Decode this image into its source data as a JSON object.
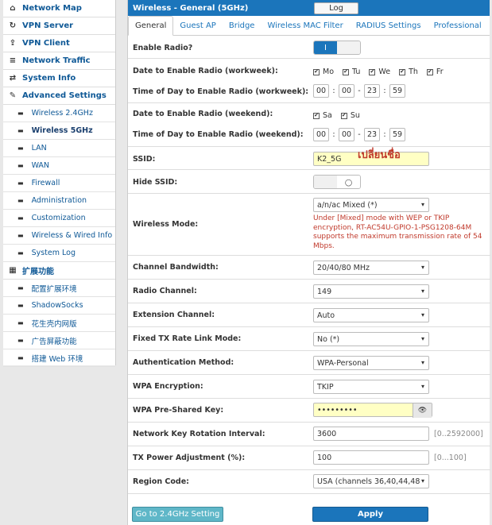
{
  "sidebar": {
    "top_items": [
      {
        "label": "Network Map",
        "icon": "home-icon",
        "glyph": "⌂"
      },
      {
        "label": "VPN Server",
        "icon": "refresh-icon",
        "glyph": "↻"
      },
      {
        "label": "VPN Client",
        "icon": "upload-icon",
        "glyph": "⇪"
      },
      {
        "label": "Network Traffic",
        "icon": "list-icon",
        "glyph": "≡"
      },
      {
        "label": "System Info",
        "icon": "shuffle-icon",
        "glyph": "⇄"
      },
      {
        "label": "Advanced Settings",
        "icon": "wrench-icon",
        "glyph": "✎"
      }
    ],
    "sub_items": [
      "Wireless 2.4GHz",
      "Wireless 5GHz",
      "LAN",
      "WAN",
      "Firewall",
      "Administration",
      "Customization",
      "Wireless & Wired Info",
      "System Log"
    ],
    "ext_title": "扩展功能",
    "ext_items": [
      "配置扩展环境",
      "ShadowSocks",
      "花生壳内网版",
      "广告屏蔽功能",
      "搭建 Web 环境"
    ]
  },
  "header": {
    "title": "Wireless - General (5GHz)",
    "logout": "Log"
  },
  "tabs": [
    "General",
    "Guest AP",
    "Bridge",
    "Wireless MAC Filter",
    "RADIUS Settings",
    "Professional"
  ],
  "form": {
    "enable_radio": {
      "label": "Enable Radio?",
      "value": "I"
    },
    "date_workweek": {
      "label": "Date to Enable Radio (workweek):",
      "days": [
        "Mo",
        "Tu",
        "We",
        "Th",
        "Fr"
      ]
    },
    "time_workweek": {
      "label": "Time of Day to Enable Radio (workweek):",
      "h1": "00",
      "m1": "00",
      "h2": "23",
      "m2": "59"
    },
    "date_weekend": {
      "label": "Date to Enable Radio (weekend):",
      "days": [
        "Sa",
        "Su"
      ]
    },
    "time_weekend": {
      "label": "Time of Day to Enable Radio (weekend):",
      "h1": "00",
      "m1": "00",
      "h2": "23",
      "m2": "59"
    },
    "ssid": {
      "label": "SSID:",
      "value": "K2_5G",
      "annotation": "เปลี่ยนชื่อ"
    },
    "hide_ssid": {
      "label": "Hide SSID:"
    },
    "wireless_mode": {
      "label": "Wireless Mode:",
      "value": "a/n/ac Mixed (*)",
      "warning": "Under [Mixed] mode with WEP or TKIP encryption, RT-AC54U-GPIO-1-PSG1208-64M supports the maximum transmission rate of 54 Mbps."
    },
    "channel_bandwidth": {
      "label": "Channel Bandwidth:",
      "value": "20/40/80 MHz"
    },
    "radio_channel": {
      "label": "Radio Channel:",
      "value": "149"
    },
    "extension_channel": {
      "label": "Extension Channel:",
      "value": "Auto"
    },
    "fixed_tx": {
      "label": "Fixed TX Rate Link Mode:",
      "value": "No (*)"
    },
    "auth_method": {
      "label": "Authentication Method:",
      "value": "WPA-Personal"
    },
    "wpa_encryption": {
      "label": "WPA Encryption:",
      "value": "TKIP"
    },
    "wpa_psk": {
      "label": "WPA Pre-Shared Key:",
      "value": "•••••••••"
    },
    "key_rotation": {
      "label": "Network Key Rotation Interval:",
      "value": "3600",
      "hint": "[0..2592000]"
    },
    "tx_power": {
      "label": "TX Power Adjustment (%):",
      "value": "100",
      "hint": "[0...100]"
    },
    "region_code": {
      "label": "Region Code:",
      "value": "USA (channels 36,40,44,48"
    }
  },
  "buttons": {
    "goto_24": "Go to 2.4GHz Setting",
    "apply": "Apply"
  },
  "colors": {
    "accent": "#1b75bb",
    "warning": "#c0392b",
    "highlight": "#ffffc4"
  }
}
